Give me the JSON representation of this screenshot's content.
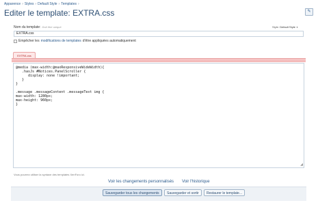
{
  "breadcrumb": {
    "items": [
      "Apparence",
      "Styles",
      "Default Style",
      "Templates"
    ],
    "separator": "›"
  },
  "page": {
    "title_prefix": "Editer le template: ",
    "title_name": "EXTRA.css"
  },
  "form": {
    "name_label": "Nom du template:",
    "name_hint": "Doit être unique",
    "name_value": "EXTRA.css",
    "style_label": "Style:",
    "style_value": "Default Style",
    "checkbox_text_before": "Empêcher les ",
    "checkbox_link": "modifications de templates",
    "checkbox_text_after": " d'être appliquées automatiquement"
  },
  "editor": {
    "tab_label": "EXTRA.css",
    "code_lines": [
      "@media (max-width:@maxResponsiveWideWidth){",
      "   .hasJs #Notices.PanelScroller {",
      "      display: none !important;",
      "   }",
      "}",
      "",
      ".message .messageContent .messageText img {",
      "max-width: 1280px;",
      "max-height: 960px;",
      "}"
    ],
    "help_text": "Vous pourrez utiliser la syntaxe des templates XenForo ici."
  },
  "links": {
    "view_changes": "Voir les changements personnalisés",
    "view_history": "Voir l'historique"
  },
  "buttons": {
    "save_all": "Sauvegarder tous les changements",
    "save_exit": "Sauvegarder et sortir",
    "restore": "Restaurer le template..."
  },
  "icons": {
    "top_right": "edit-icon",
    "resize_grip": "resize-grip-icon"
  },
  "colors": {
    "title": "#2b4d72",
    "link": "#2b5a8c",
    "tab_accent": "#e9a3a3"
  }
}
